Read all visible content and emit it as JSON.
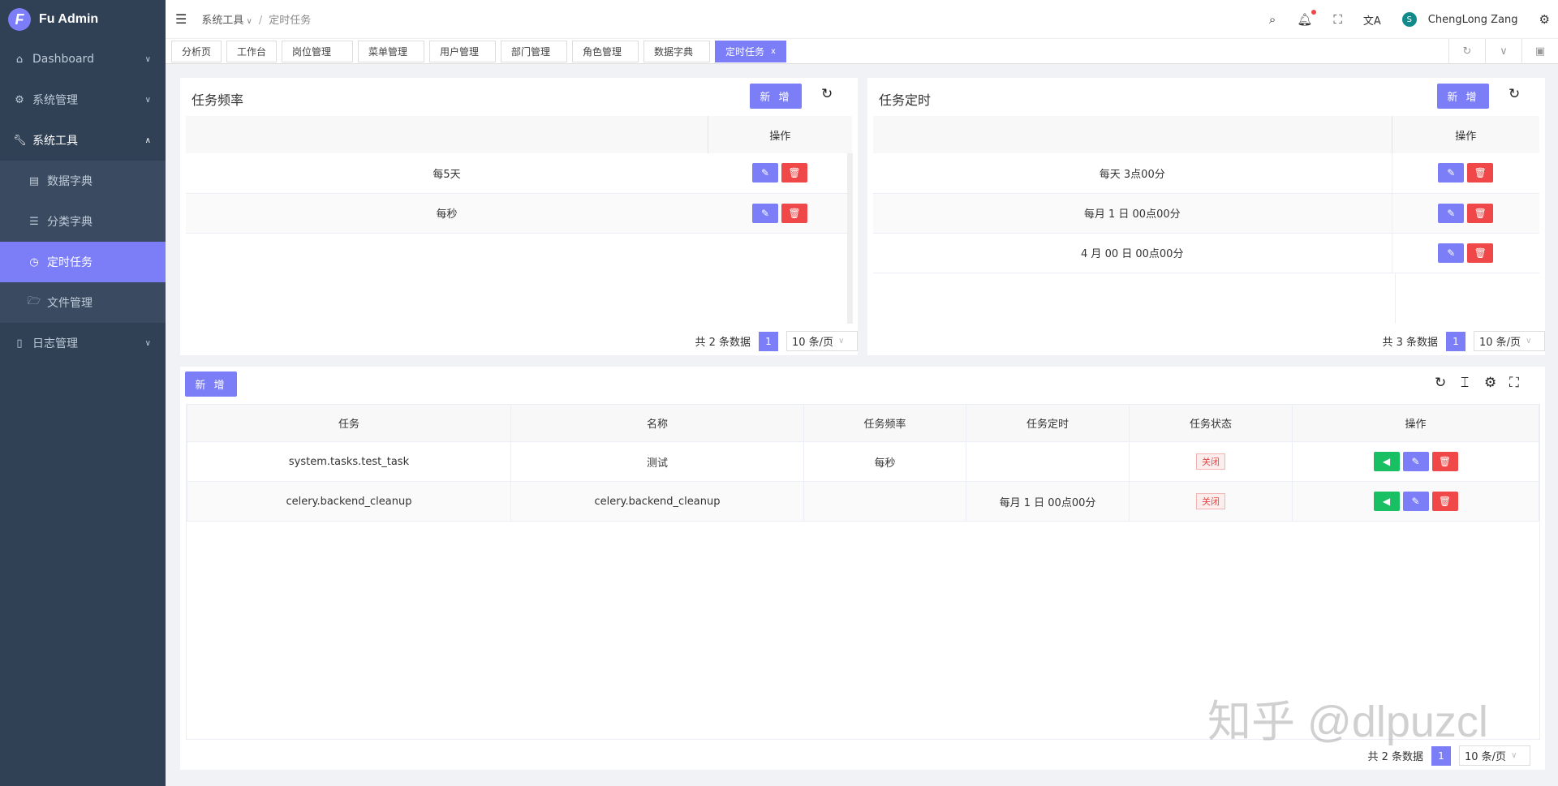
{
  "app": {
    "title": "Fu Admin",
    "logo_letter": "F"
  },
  "sidebar": {
    "items": [
      {
        "label": "Dashboard",
        "icon": "home-icon"
      },
      {
        "label": "系统管理",
        "icon": "gear-icon"
      },
      {
        "label": "系统工具",
        "icon": "wrench-icon"
      },
      {
        "label": "数据字典",
        "icon": "book-icon"
      },
      {
        "label": "分类字典",
        "icon": "list-icon"
      },
      {
        "label": "定时任务",
        "icon": "clock-icon"
      },
      {
        "label": "文件管理",
        "icon": "folder-icon"
      },
      {
        "label": "日志管理",
        "icon": "document-icon"
      }
    ]
  },
  "header": {
    "breadcrumb": [
      "系统工具",
      "定时任务"
    ],
    "user": "ChengLong Zang",
    "avatar_letter": "S"
  },
  "tabs": [
    "分析页",
    "工作台",
    "岗位管理",
    "菜单管理",
    "用户管理",
    "部门管理",
    "角色管理",
    "数据字典",
    "定时任务"
  ],
  "freq_card": {
    "title": "任务频率",
    "add": "新 增",
    "op_header": "操作",
    "rows": [
      "每5天",
      "每秒"
    ],
    "total": "共 2 条数据",
    "page": "1",
    "page_size": "10 条/页"
  },
  "cron_card": {
    "title": "任务定时",
    "add": "新 增",
    "op_header": "操作",
    "rows": [
      "每天 3点00分",
      "每月 1 日 00点00分",
      "4 月 00 日 00点00分"
    ],
    "total": "共 3 条数据",
    "page": "1",
    "page_size": "10 条/页"
  },
  "task_card": {
    "add": "新 增",
    "columns": [
      "任务",
      "名称",
      "任务频率",
      "任务定时",
      "任务状态",
      "操作"
    ],
    "rows": [
      {
        "task": "system.tasks.test_task",
        "name": "测试",
        "freq": "每秒",
        "cron": "",
        "status": "关闭"
      },
      {
        "task": "celery.backend_cleanup",
        "name": "celery.backend_cleanup",
        "freq": "",
        "cron": "每月 1 日 00点00分",
        "status": "关闭"
      }
    ],
    "total": "共 2 条数据",
    "page": "1",
    "page_size": "10 条/页"
  },
  "watermark": "知乎 @dlpuzcl",
  "colors": {
    "accent": "#7b7ef7",
    "sidebar": "#304156",
    "danger": "#f04848",
    "success": "#18c063"
  }
}
